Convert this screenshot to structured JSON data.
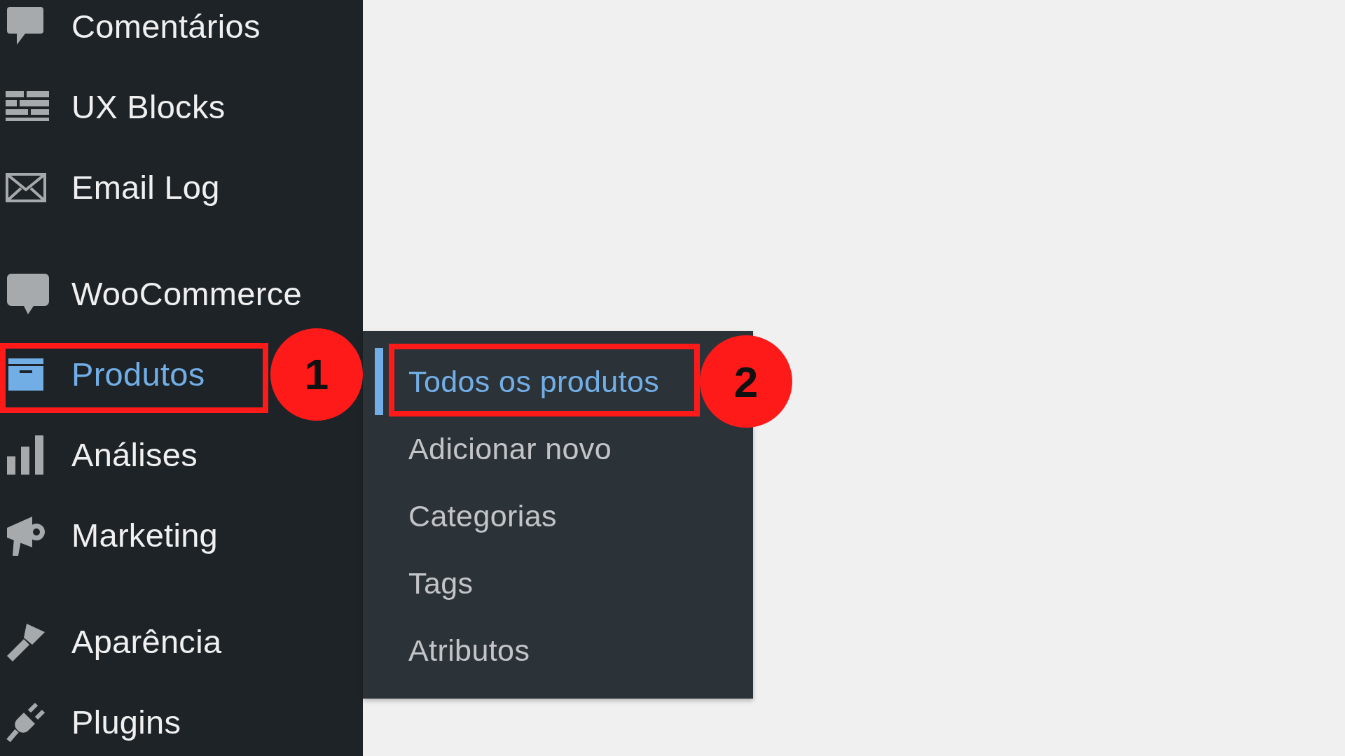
{
  "sidebar": {
    "groups": [
      {
        "items": [
          {
            "label": "Comentários",
            "selected": false
          },
          {
            "label": "UX Blocks",
            "selected": false
          },
          {
            "label": "Email Log",
            "selected": false
          }
        ]
      },
      {
        "items": [
          {
            "label": "WooCommerce",
            "selected": false
          },
          {
            "label": "Produtos",
            "selected": true,
            "annotation": "1"
          },
          {
            "label": "Análises",
            "selected": false
          },
          {
            "label": "Marketing",
            "selected": false
          }
        ]
      },
      {
        "items": [
          {
            "label": "Aparência",
            "selected": false
          },
          {
            "label": "Plugins",
            "selected": false
          }
        ]
      }
    ]
  },
  "submenu": {
    "items": [
      {
        "label": "Todos os produtos",
        "selected": true,
        "annotation": "2"
      },
      {
        "label": "Adicionar novo",
        "selected": false
      },
      {
        "label": "Categorias",
        "selected": false
      },
      {
        "label": "Tags",
        "selected": false
      },
      {
        "label": "Atributos",
        "selected": false
      }
    ]
  }
}
